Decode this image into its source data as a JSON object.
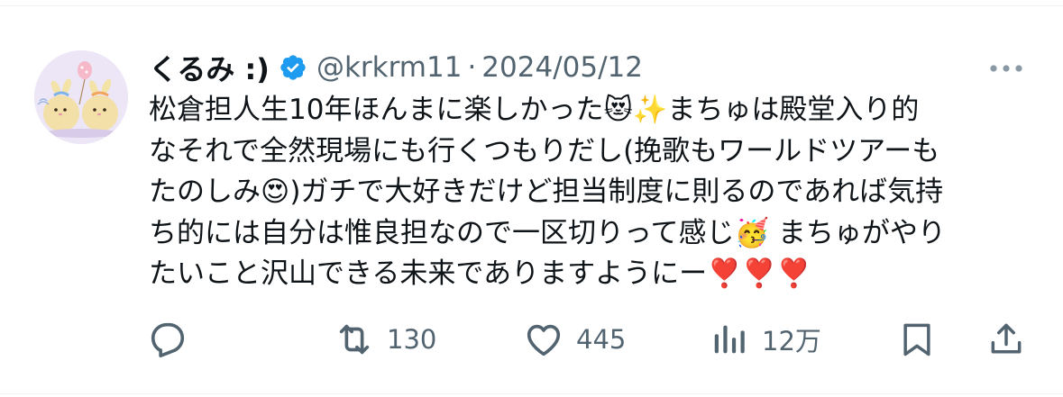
{
  "tweet": {
    "display_name": "くるみ :)",
    "handle": "@krkrm11",
    "separator": "·",
    "date": "2024/05/12",
    "text": "松倉担人生10年ほんまに楽しかった😻✨まちゅは殿堂入り的\nなそれで全然現場にも行くつもりだし(挽歌もワールドツアーも\nたのしみ😍)ガチで大好きだけど担当制度に則るのであれば気持\nち的には自分は惟良担なので一区切りって感じ🥳 まちゅがやり\nたいこと沢山できる未来でありますようにー❣️❣️❣️"
  },
  "icons": {
    "verified": "verified-badge-icon",
    "more": "more-icon",
    "reply": "reply-icon",
    "retweet": "retweet-icon",
    "like": "like-icon",
    "views": "views-icon",
    "bookmark": "bookmark-icon",
    "share": "share-icon"
  },
  "actions": {
    "retweet_count": "130",
    "like_count": "445",
    "views_count": "12万"
  },
  "colors": {
    "text": "#0f1419",
    "secondary": "#536471",
    "verified": "#1d9bf0",
    "border": "#eff3f4"
  }
}
